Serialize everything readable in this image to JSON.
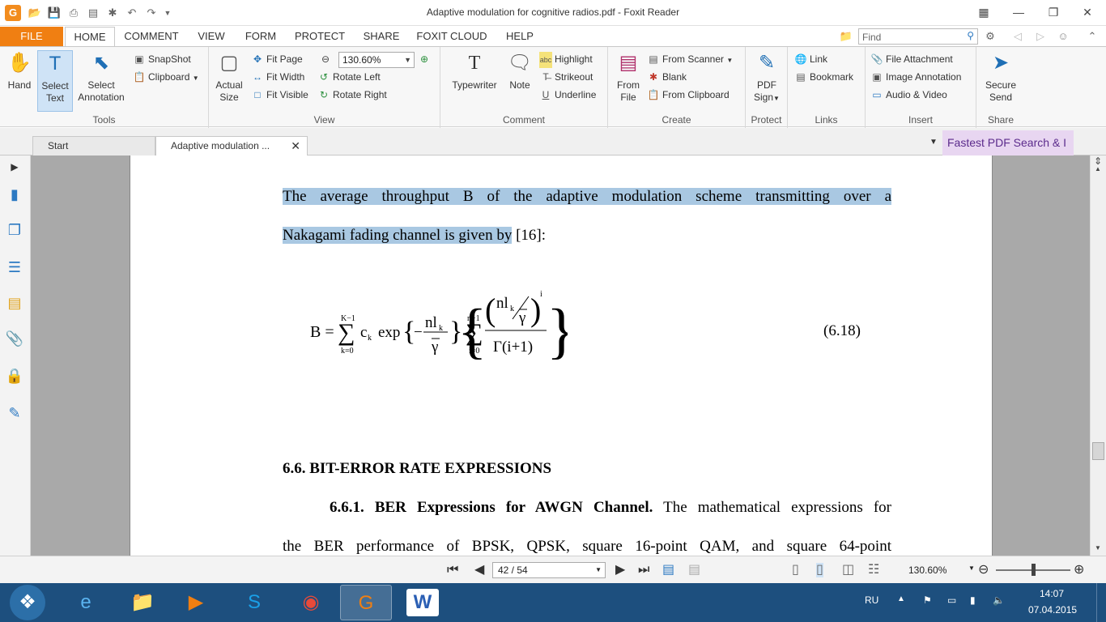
{
  "window": {
    "title": "Adaptive modulation for cognitive radios.pdf - Foxit Reader"
  },
  "menu": {
    "tabs": [
      "FILE",
      "HOME",
      "COMMENT",
      "VIEW",
      "FORM",
      "PROTECT",
      "SHARE",
      "FOXIT CLOUD",
      "HELP"
    ],
    "find_placeholder": "Find"
  },
  "ribbon": {
    "tools": {
      "label": "Tools",
      "hand": "Hand",
      "select_text_1": "Select",
      "select_text_2": "Text",
      "select_annot_1": "Select",
      "select_annot_2": "Annotation",
      "snapshot": "SnapShot",
      "clipboard": "Clipboard"
    },
    "view": {
      "label": "View",
      "actual_1": "Actual",
      "actual_2": "Size",
      "fit_page": "Fit Page",
      "fit_width": "Fit Width",
      "fit_visible": "Fit Visible",
      "zoom": "130.60%",
      "rotate_left": "Rotate Left",
      "rotate_right": "Rotate Right"
    },
    "comment": {
      "label": "Comment",
      "typewriter": "Typewriter",
      "note": "Note",
      "highlight": "Highlight",
      "strikeout": "Strikeout",
      "underline": "Underline"
    },
    "create": {
      "label": "Create",
      "from_file_1": "From",
      "from_file_2": "File",
      "from_scanner": "From Scanner",
      "blank": "Blank",
      "from_clipboard": "From Clipboard"
    },
    "protect": {
      "label": "Protect",
      "pdf_sign_1": "PDF",
      "pdf_sign_2": "Sign"
    },
    "links": {
      "label": "Links",
      "link": "Link",
      "bookmark": "Bookmark"
    },
    "insert": {
      "label": "Insert",
      "file_attachment": "File Attachment",
      "image_annotation": "Image Annotation",
      "audio_video": "Audio & Video"
    },
    "share": {
      "label": "Share",
      "secure_1": "Secure",
      "secure_2": "Send"
    }
  },
  "doc_tabs": {
    "start": "Start",
    "active": "Adaptive modulation ...",
    "ad": "Fastest PDF Search & I"
  },
  "document": {
    "line1": "The average throughput B of the adaptive modulation scheme transmitting over a",
    "line2_hl": "Nakagami fading channel is given by",
    "line2_rest": " [16]:",
    "eq_number": "(6.18)",
    "heading": "6.6. BIT-ERROR RATE EXPRESSIONS",
    "sub_bold": "6.6.1. BER Expressions for AWGN Channel.",
    "sub_rest": " The mathematical expressions for",
    "line_last": "the BER performance of BPSK, QPSK, square 16-point QAM, and square 64-point"
  },
  "status": {
    "page": "42 / 54",
    "zoom": "130.60%"
  },
  "taskbar": {
    "lang": "RU",
    "time": "14:07",
    "date": "07.04.2015"
  },
  "colors": {
    "accent": "#f07f12",
    "highlight": "#a9c8e2",
    "taskbar": "#1d4f7e"
  }
}
